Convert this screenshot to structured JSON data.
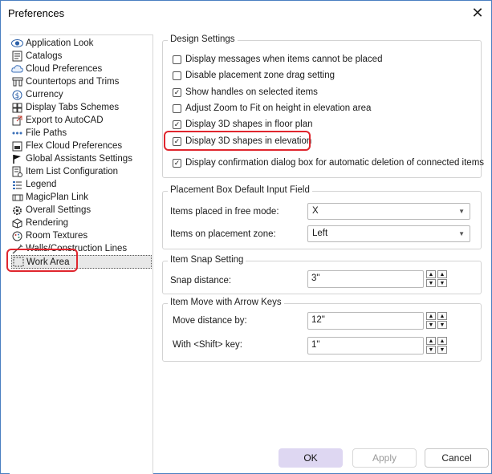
{
  "window": {
    "title": "Preferences"
  },
  "tree": {
    "items": [
      {
        "label": "Application Look",
        "icon": "eye-icon"
      },
      {
        "label": "Catalogs",
        "icon": "catalog-icon"
      },
      {
        "label": "Cloud Preferences",
        "icon": "cloud-icon"
      },
      {
        "label": "Countertops and Trims",
        "icon": "countertop-icon"
      },
      {
        "label": "Currency",
        "icon": "currency-icon"
      },
      {
        "label": "Display Tabs Schemes",
        "icon": "tabs-icon"
      },
      {
        "label": "Export to AutoCAD",
        "icon": "export-icon"
      },
      {
        "label": "File Paths",
        "icon": "dots-icon"
      },
      {
        "label": "Flex Cloud Preferences",
        "icon": "flex-cloud-icon"
      },
      {
        "label": "Global Assistants Settings",
        "icon": "flag-icon"
      },
      {
        "label": "Item List Configuration",
        "icon": "list-icon"
      },
      {
        "label": "Legend",
        "icon": "legend-icon"
      },
      {
        "label": "MagicPlan Link",
        "icon": "link-icon"
      },
      {
        "label": "Overall Settings",
        "icon": "gear-icon"
      },
      {
        "label": "Rendering",
        "icon": "rendering-icon"
      },
      {
        "label": "Room Textures",
        "icon": "texture-icon"
      },
      {
        "label": "Walls/Construction Lines",
        "icon": "wall-icon"
      },
      {
        "label": "Work Area",
        "icon": "work-area-icon"
      }
    ],
    "selected": "Work Area"
  },
  "design_settings": {
    "legend": "Design Settings",
    "options": [
      {
        "label": "Display messages when items cannot be placed",
        "checked": false
      },
      {
        "label": "Disable placement zone drag setting",
        "checked": false
      },
      {
        "label": "Show handles on selected items",
        "checked": true
      },
      {
        "label": "Adjust Zoom to Fit on height in elevation area",
        "checked": false
      },
      {
        "label": "Display 3D shapes in floor plan",
        "checked": true
      },
      {
        "label": "Display 3D shapes in elevation",
        "checked": true
      },
      {
        "label": "Display confirmation dialog box for automatic deletion of connected items",
        "checked": true
      }
    ]
  },
  "placement_box": {
    "legend": "Placement Box Default Input Field",
    "free_mode_label": "Items placed in free mode:",
    "free_mode_value": "X",
    "zone_label": "Items on placement zone:",
    "zone_value": "Left"
  },
  "snap": {
    "legend": "Item Snap Setting",
    "distance_label": "Snap distance:",
    "distance_value": "3\""
  },
  "arrow_keys": {
    "legend": "Item Move with Arrow Keys",
    "move_label": "Move distance by:",
    "move_value": "12\"",
    "shift_label": "With <Shift> key:",
    "shift_value": "1\""
  },
  "buttons": {
    "ok": "OK",
    "apply": "Apply",
    "cancel": "Cancel"
  },
  "colors": {
    "highlight": "#e0262e",
    "ok_bg": "#ded7f2",
    "window_border": "#4a7fc1"
  }
}
